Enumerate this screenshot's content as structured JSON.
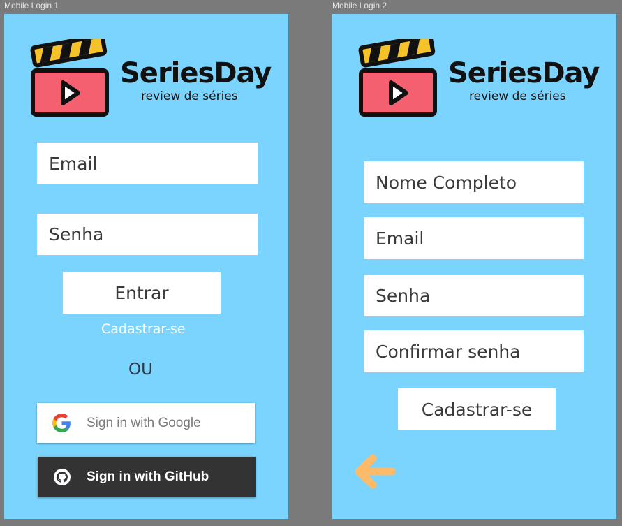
{
  "frames": [
    {
      "label": "Mobile Login 1",
      "brand": "SeriesDay",
      "tagline": "review de séries",
      "email_placeholder": "Email",
      "password_placeholder": "Senha",
      "login_button": "Entrar",
      "signup_link": "Cadastrar-se",
      "or_text": "OU",
      "google_button": "Sign in with Google",
      "github_button": "Sign in with GitHub"
    },
    {
      "label": "Mobile Login 2",
      "brand": "SeriesDay",
      "tagline": "review de séries",
      "name_placeholder": "Nome Completo",
      "email_placeholder": "Email",
      "password_placeholder": "Senha",
      "confirm_placeholder": "Confirmar senha",
      "signup_button": "Cadastrar-se",
      "back_icon": "arrow-left-icon"
    }
  ],
  "colors": {
    "frame_background": "#7bd4fd",
    "canvas_background": "#7a7a7a",
    "clapper_red": "#f4606f",
    "clapper_yellow": "#f5c22a",
    "arrow_orange": "#fdbb6a",
    "github_dark": "#333333"
  }
}
